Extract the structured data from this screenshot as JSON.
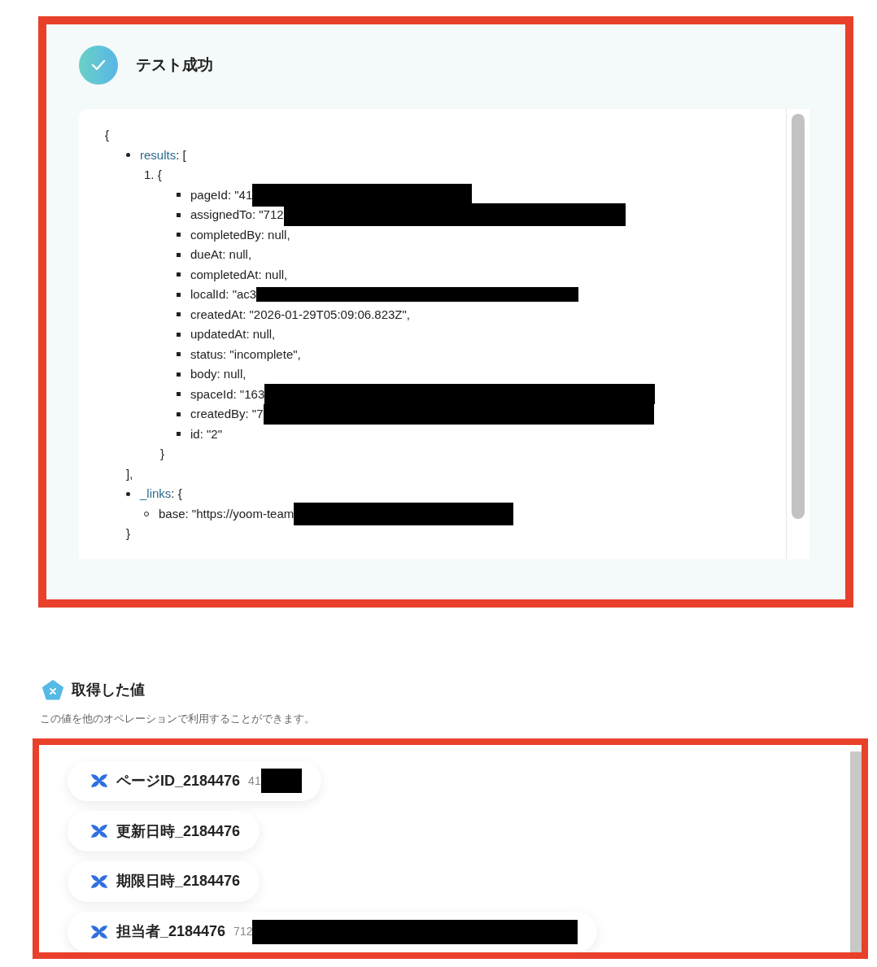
{
  "test_result": {
    "title": "テスト成功"
  },
  "output": {
    "open": "{",
    "fields": [
      {
        "key": "results",
        "suffix": ": [",
        "close": "],",
        "children": [
          {
            "number": "1.",
            "open": "{",
            "close": "}",
            "children": [
              {
                "text": "pageId: \"41",
                "redacted": true
              },
              {
                "text": "assignedTo: \"712",
                "redacted": true
              },
              {
                "text": "completedBy: null,",
                "redacted": false
              },
              {
                "text": "dueAt: null,",
                "redacted": false
              },
              {
                "text": "completedAt: null,",
                "redacted": false
              },
              {
                "text": "localId: \"ac3",
                "redacted": true
              },
              {
                "text": "createdAt: \"2026-01-29T05:09:06.823Z\",",
                "redacted": false
              },
              {
                "text": "updatedAt: null,",
                "redacted": false
              },
              {
                "text": "status: \"incomplete\",",
                "redacted": false
              },
              {
                "text": "body: null,",
                "redacted": false
              },
              {
                "text": "spaceId: \"163",
                "redacted": true
              },
              {
                "text": "createdBy: \"7",
                "redacted": true
              },
              {
                "text": "id: \"2\"",
                "redacted": false
              }
            ]
          }
        ]
      },
      {
        "key": "_links",
        "suffix": ": {",
        "close": "}",
        "children": [
          {
            "text": "base: \"https://yoom-team",
            "redacted": true
          }
        ]
      }
    ]
  },
  "values_section": {
    "title": "取得した値",
    "description": "この値を他のオペレーションで利用することができます。",
    "chips": [
      {
        "label": "ページID_2184476",
        "value": "41",
        "redacted": true
      },
      {
        "label": "更新日時_2184476"
      },
      {
        "label": "期限日時_2184476"
      },
      {
        "label": "担当者_2184476",
        "value": "712",
        "redacted": true
      }
    ]
  }
}
